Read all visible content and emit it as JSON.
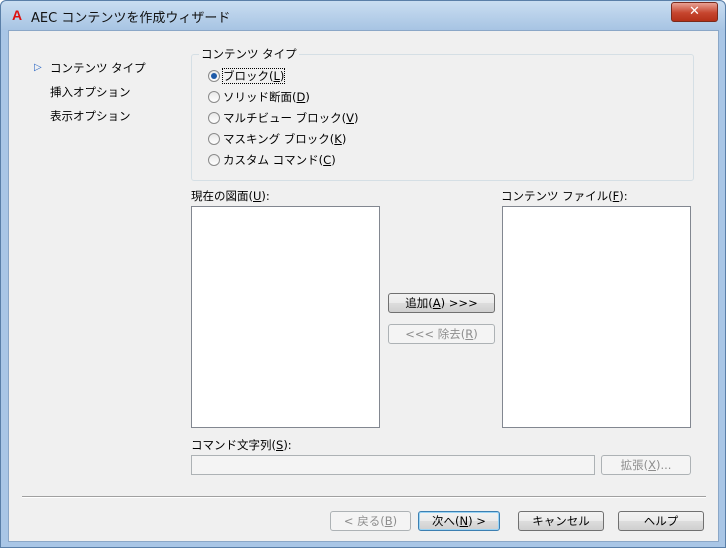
{
  "window": {
    "title": "AEC コンテンツを作成ウィザード",
    "app_icon": "A",
    "close_glyph": "✕"
  },
  "nav": {
    "items": [
      "コンテンツ タイプ",
      "挿入オプション",
      "表示オプション"
    ],
    "active_marker": "▷"
  },
  "content_type": {
    "group_label": "コンテンツ タイプ",
    "options": [
      {
        "text": "ブロック(",
        "key": "L",
        "end": ")",
        "checked": true
      },
      {
        "text": "ソリッド断面(",
        "key": "D",
        "end": ")",
        "checked": false
      },
      {
        "text": "マルチビュー ブロック(",
        "key": "V",
        "end": ")",
        "checked": false
      },
      {
        "text": "マスキング ブロック(",
        "key": "K",
        "end": ")",
        "checked": false
      },
      {
        "text": "カスタム コマンド(",
        "key": "C",
        "end": ")",
        "checked": false
      }
    ]
  },
  "lists": {
    "current_drawing_label_pre": "現在の図面(",
    "current_drawing_key": "U",
    "current_drawing_label_post": "):",
    "content_file_label_pre": "コンテンツ ファイル(",
    "content_file_key": "F",
    "content_file_label_post": "):"
  },
  "transfer": {
    "add_pre": "追加(",
    "add_key": "A",
    "add_post": ") >>>",
    "remove_pre": "<<< 除去(",
    "remove_key": "R",
    "remove_post": ")"
  },
  "command": {
    "label_pre": "コマンド文字列(",
    "label_key": "S",
    "label_post": "):",
    "value": "",
    "expand_pre": "拡張(",
    "expand_key": "X",
    "expand_post": ")..."
  },
  "footer": {
    "back_pre": "< 戻る(",
    "back_key": "B",
    "back_post": ")",
    "next_pre": "次へ(",
    "next_key": "N",
    "next_post": ") >",
    "cancel": "キャンセル",
    "help": "ヘルプ"
  },
  "colors": {
    "accent": "#1e5aa8",
    "close_button": "#c6452e",
    "titlebar": "#b7d0ea"
  }
}
